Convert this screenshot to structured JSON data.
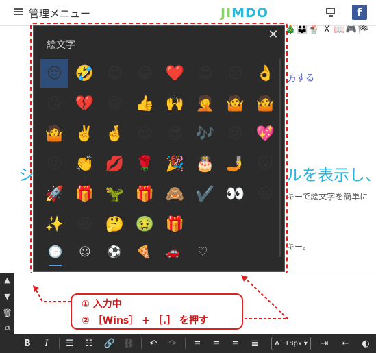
{
  "header": {
    "menu_label": "管理メニュー",
    "logo_part1": "JI",
    "logo_part2": "MDO",
    "facebook_glyph": "f"
  },
  "page": {
    "emoji_strip": "🎄👪🍨 X 📖🎮🏁",
    "link_fragment": "方する",
    "heading_left": "シ",
    "heading_right": "ルを表示し、",
    "body_fragment": "キーで絵文字を簡単に",
    "body_fragment2": "キー。"
  },
  "emoji_panel": {
    "title": "絵文字",
    "close_glyph": "✕",
    "rows": [
      [
        "😔",
        "🤣",
        "😊",
        "😂",
        "❤️",
        "😍",
        "😒",
        "👌"
      ],
      [
        "😘",
        "💔",
        "😁",
        "👍",
        "🙌",
        "🤦",
        "🤷",
        "🤷"
      ],
      [
        "🤷",
        "✌️",
        "🤞",
        "😉",
        "😎",
        "🎶",
        "😢",
        "💖"
      ],
      [
        "😜",
        "👏",
        "💋",
        "🌹",
        "🎉",
        "🎂",
        "🤳",
        "🐱"
      ],
      [
        "🚀",
        "🎁",
        "🦖",
        "🎁",
        "🙈",
        "✔️",
        "👀",
        "😃"
      ],
      [
        "✨",
        "😆",
        "🤔",
        "🤢",
        "🎁"
      ]
    ],
    "tabs": [
      "🕒",
      "☺",
      "⚽",
      "🍕",
      "🚗",
      "♡",
      "🍕"
    ]
  },
  "callout": {
    "line1": "① 入力中",
    "line2": "② ［Wins］ + ［.］ を押す"
  },
  "toolbar": {
    "bold": "B",
    "italic": "I",
    "font_size": "18px"
  },
  "colors": {
    "panel_bg": "#2b2b2b",
    "selected": "#2f4d79",
    "annotation_red": "#e02020",
    "accent_blue": "#27b6e0"
  }
}
